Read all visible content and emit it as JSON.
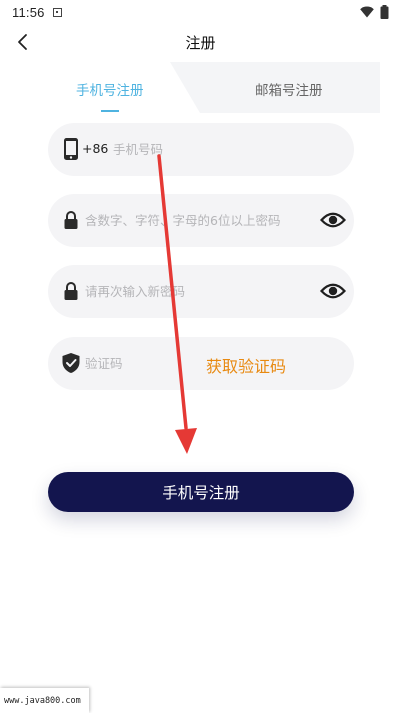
{
  "status_bar": {
    "time": "11:56"
  },
  "header": {
    "title": "注册"
  },
  "tabs": [
    {
      "label": "手机号注册",
      "active": true
    },
    {
      "label": "邮箱号注册",
      "active": false
    }
  ],
  "form": {
    "phone": {
      "country_code": "+86",
      "placeholder": "手机号码"
    },
    "password": {
      "placeholder": "含数字、字符、字母的6位以上密码"
    },
    "confirm_password": {
      "placeholder": "请再次输入新密码"
    },
    "code": {
      "placeholder": "验证码",
      "get_code_label": "获取验证码"
    }
  },
  "submit_label": "手机号注册",
  "watermark": "www.java800.com",
  "colors": {
    "accent": "#4fb3e0",
    "primary_button": "#13154e",
    "code_link": "#e88a12",
    "annotation_arrow": "#e53935"
  }
}
